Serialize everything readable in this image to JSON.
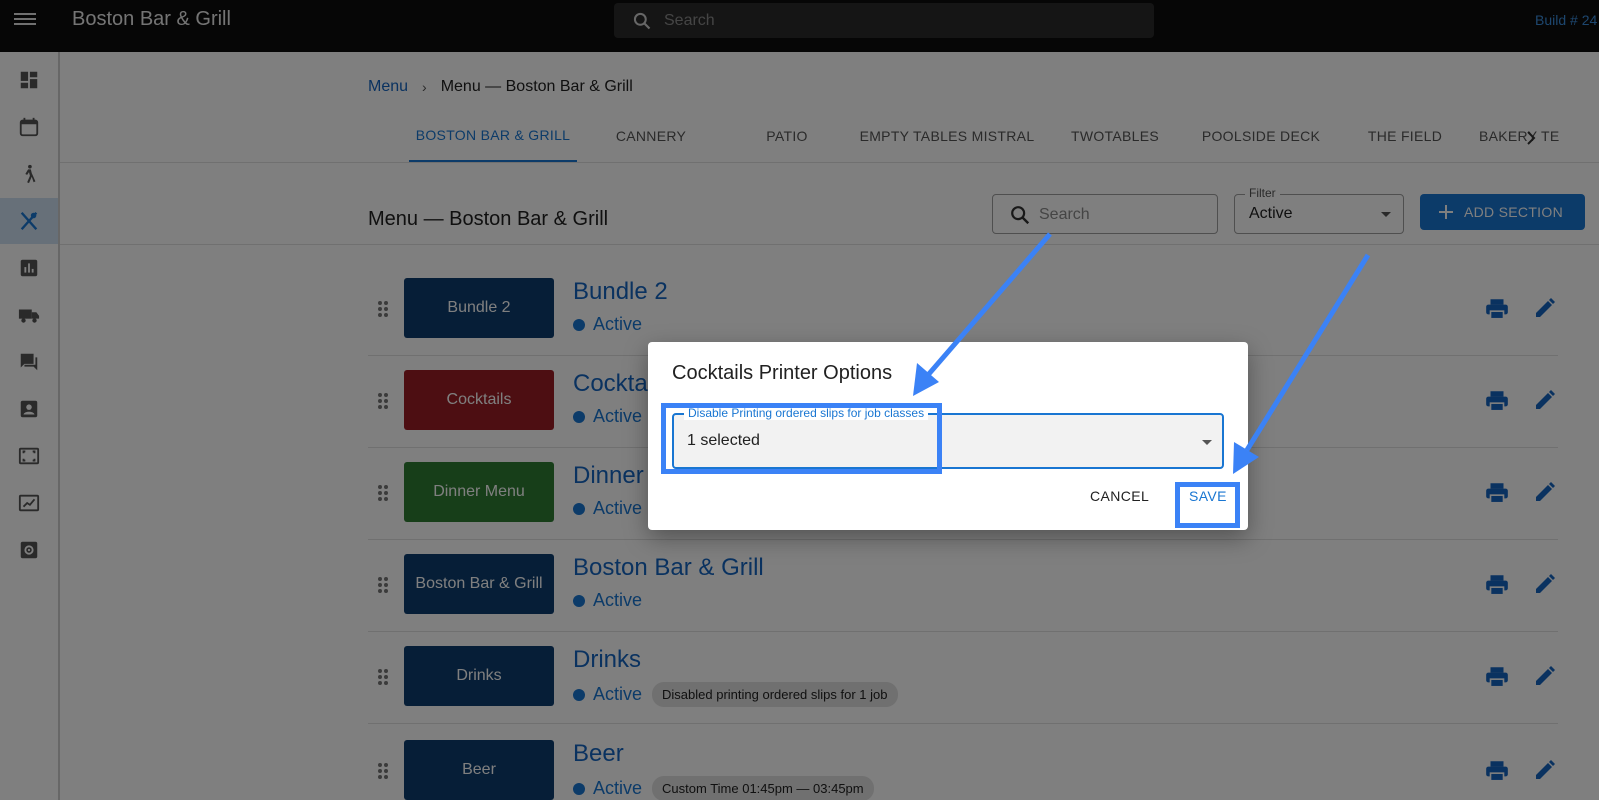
{
  "topbar": {
    "title": "Boston Bar & Grill",
    "search_placeholder": "Search",
    "build": "Build # 24"
  },
  "sidebar": {
    "items": [
      {
        "icon": "dashboard-icon"
      },
      {
        "icon": "calendar-icon"
      },
      {
        "icon": "walking-person-icon"
      },
      {
        "icon": "fork-knife-icon",
        "active": true
      },
      {
        "icon": "bar-chart-icon"
      },
      {
        "icon": "truck-icon"
      },
      {
        "icon": "chat-icon"
      },
      {
        "icon": "contact-icon"
      },
      {
        "icon": "scan-frame-icon"
      },
      {
        "icon": "picture-frame-icon"
      },
      {
        "icon": "settings-box-icon"
      }
    ]
  },
  "breadcrumb": {
    "link": "Menu",
    "current": "Menu — Boston Bar & Grill"
  },
  "tabs": [
    "BOSTON BAR & GRILL",
    "CANNERY",
    "PATIO",
    "EMPTY TABLES MISTRAL",
    "TWOTABLES",
    "POOLSIDE DECK",
    "THE FIELD",
    "BAKERY TE"
  ],
  "section": {
    "title": "Menu — Boston Bar & Grill",
    "search_placeholder": "Search",
    "filter_label": "Filter",
    "filter_value": "Active",
    "add_button": "ADD SECTION"
  },
  "rows": [
    {
      "tile": "Bundle 2",
      "tile_color": "#0d3d6e",
      "name": "Bundle 2",
      "status": "Active",
      "chip": ""
    },
    {
      "tile": "Cocktails",
      "tile_color": "#9b1c24",
      "name": "Cocktails",
      "status": "Active",
      "chip": ""
    },
    {
      "tile": "Dinner Menu",
      "tile_color": "#2e7d32",
      "name": "Dinner Menu",
      "status": "Active",
      "chip": ""
    },
    {
      "tile": "Boston Bar & Grill",
      "tile_color": "#0d3d6e",
      "name": "Boston Bar & Grill",
      "status": "Active",
      "chip": ""
    },
    {
      "tile": "Drinks",
      "tile_color": "#0d3d6e",
      "name": "Drinks",
      "status": "Active",
      "chip": "Disabled printing ordered slips for 1 job"
    },
    {
      "tile": "Beer",
      "tile_color": "#0d3d6e",
      "name": "Beer",
      "status": "Active",
      "chip": "Custom Time 01:45pm — 03:45pm"
    }
  ],
  "dialog": {
    "title": "Cocktails Printer Options",
    "field_label": "Disable Printing ordered slips for job classes",
    "field_value": "1 selected",
    "cancel": "CANCEL",
    "save": "SAVE"
  },
  "colors": {
    "primary": "#1976d2",
    "annotation": "#3b82f6",
    "topbar": "#0d0d0d"
  }
}
